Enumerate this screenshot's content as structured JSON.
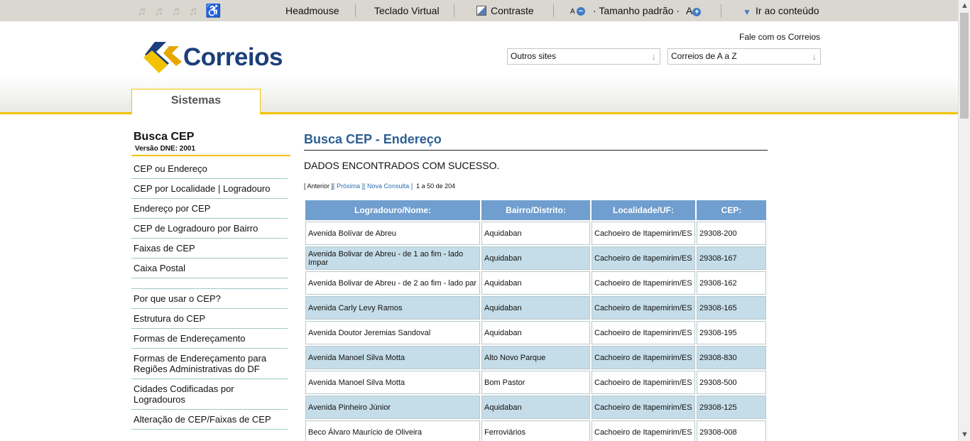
{
  "accessibility_bar": {
    "headmouse": "Headmouse",
    "teclado_virtual": "Teclado Virtual",
    "contraste": "Contraste",
    "font_small": "A",
    "tamanho_padrao": "Tamanho padrão",
    "font_large": "A",
    "ir_ao_conteudo": "Ir ao conteúdo"
  },
  "header": {
    "logo_text": "Correios",
    "fale_conosco": "Fale com os Correios",
    "select_outros_sites": "Outros sites",
    "select_correios_az": "Correios de A a Z",
    "tab_sistemas": "Sistemas"
  },
  "sidebar": {
    "title": "Busca CEP",
    "version": "Versão DNE: 2001",
    "items_primary": [
      "CEP ou Endereço",
      "CEP por Localidade | Logradouro",
      "Endereço por CEP",
      "CEP de Logradouro por Bairro",
      "Faixas de CEP",
      "Caixa Postal"
    ],
    "items_secondary": [
      "Por que usar o CEP?",
      "Estrutura do CEP",
      "Formas de Endereçamento",
      "Formas de Endereçamento para Regiões Administrativas do DF",
      "Cidades Codificadas por Logradouros",
      "Alteração de CEP/Faixas de CEP"
    ]
  },
  "main": {
    "title": "Busca CEP - Endereço",
    "message": "DADOS ENCONTRADOS COM SUCESSO.",
    "pager": {
      "anterior": "[ Anterior ]",
      "proxima": "[ Próxima ]",
      "nova_consulta": "[ Nova Consulta ]",
      "count": "1 a 50 de 204"
    },
    "table": {
      "headers": [
        "Logradouro/Nome:",
        "Bairro/Distrito:",
        "Localidade/UF:",
        "CEP:"
      ],
      "rows": [
        [
          "Avenida Bolívar de Abreu",
          "Aquidaban",
          "Cachoeiro de Itapemirim/ES",
          "29308-200"
        ],
        [
          "Avenida Bolivar de Abreu - de 1 ao fim - lado ímpar",
          "Aquidaban",
          "Cachoeiro de Itapemirim/ES",
          "29308-167"
        ],
        [
          "Avenida Bolivar de Abreu - de 2 ao fim - lado par",
          "Aquidaban",
          "Cachoeiro de Itapemirim/ES",
          "29308-162"
        ],
        [
          "Avenida Carly Levy Ramos",
          "Aquidaban",
          "Cachoeiro de Itapemirim/ES",
          "29308-165"
        ],
        [
          "Avenida Doutor Jeremias Sandoval",
          "Aquidaban",
          "Cachoeiro de Itapemirim/ES",
          "29308-195"
        ],
        [
          "Avenida Manoel Silva Motta",
          "Alto Novo Parque",
          "Cachoeiro de Itapemirim/ES",
          "29308-830"
        ],
        [
          "Avenida Manoel Silva Motta",
          "Bom Pastor",
          "Cachoeiro de Itapemirim/ES",
          "29308-500"
        ],
        [
          "Avenida Pinheiro Júnior",
          "Aquidaban",
          "Cachoeiro de Itapemirim/ES",
          "29308-125"
        ],
        [
          "Beco Álvaro Maurício de Oliveira",
          "Ferroviários",
          "Cachoeiro de Itapemirim/ES",
          "29308-008"
        ]
      ]
    }
  },
  "colors": {
    "accent_yellow": "#f2c200",
    "title_blue": "#2e5f92",
    "header_blue": "#6f9ecf",
    "row_alt": "#c5dde8",
    "logo_blue": "#1b3f7a"
  }
}
